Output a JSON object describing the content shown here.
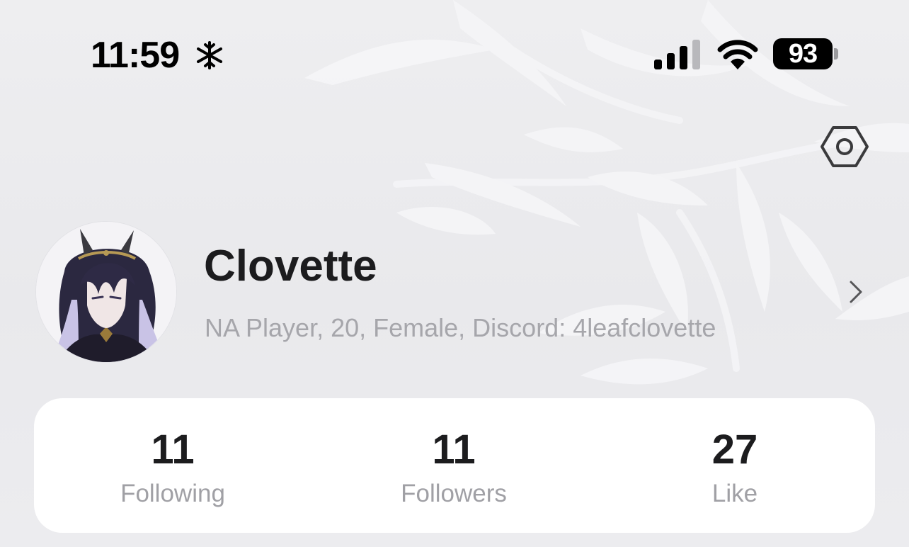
{
  "status_bar": {
    "time": "11:59",
    "time_icon": "snowflake-icon",
    "signal_icon": "cellular-signal-icon",
    "wifi_icon": "wifi-icon",
    "battery_level": "93"
  },
  "header": {
    "settings_icon": "hexagon-gear-icon"
  },
  "profile": {
    "name": "Clovette",
    "bio": "NA Player, 20, Female, Discord: 4leafclovette",
    "avatar_icon": "avatar-image",
    "chevron_icon": "chevron-right-icon"
  },
  "stats": [
    {
      "value": "11",
      "label": "Following"
    },
    {
      "value": "11",
      "label": "Followers"
    },
    {
      "value": "27",
      "label": "Like"
    }
  ],
  "colors": {
    "background": "#ececef",
    "card": "#ffffff",
    "text_primary": "#1c1c1e",
    "text_secondary": "#a6a6ab"
  }
}
